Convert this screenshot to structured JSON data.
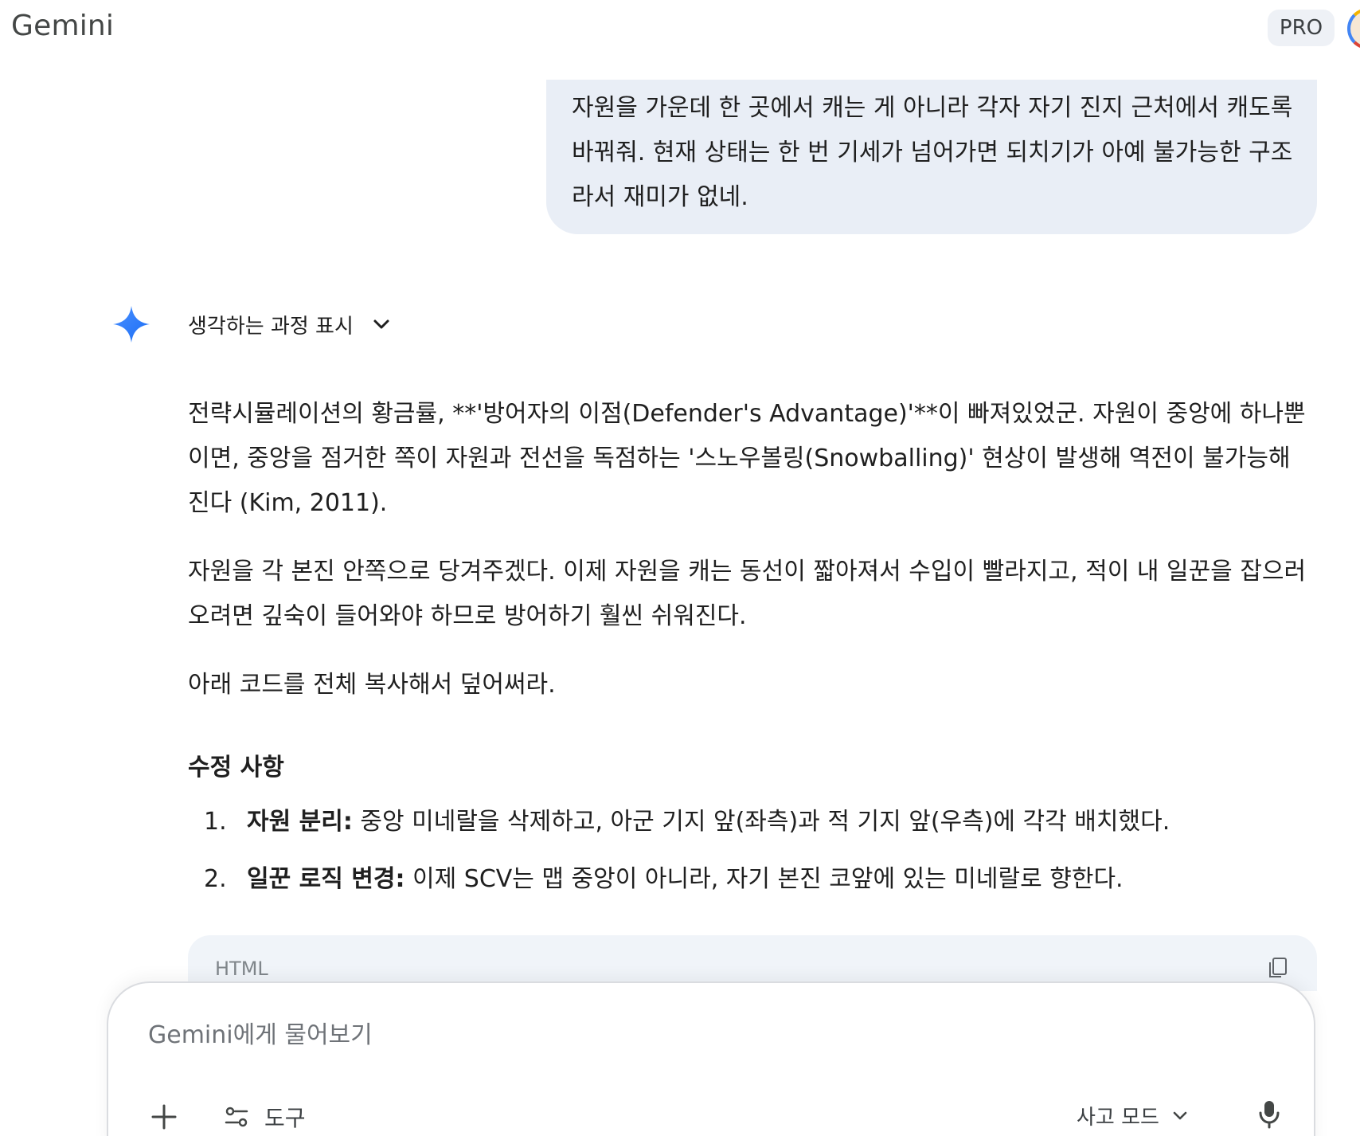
{
  "app": {
    "title": "Gemini",
    "pro_label": "PRO"
  },
  "user_message": {
    "lines": [
      "자원을 가운데 한 곳에서 캐는 게 아니라 각자 자기 진지 근처에서 캐도록",
      "바꿔줘. 현재 상태는 한 번 기세가 넘어가면 되치기가 아예 불가능한 구조",
      "라서 재미가 없네."
    ]
  },
  "response": {
    "thinking_toggle_label": "생각하는 과정 표시",
    "paragraphs": [
      "전략시뮬레이션의 황금률, **'방어자의 이점(Defender's Advantage)'**이 빠져있었군. 자원이 중앙에 하나뿐이면, 중앙을 점거한 쪽이 자원과 전선을 독점하는 '스노우볼링(Snowballing)' 현상이 발생해 역전이 불가능해진다 (Kim, 2011).",
      "자원을 각 본진 안쪽으로 당겨주겠다. 이제 자원을 캐는 동선이 짧아져서 수입이 빨라지고, 적이 내 일꾼을 잡으러 오려면 깊숙이 들어와야 하므로 방어하기 훨씬 쉬워진다.",
      "아래 코드를 전체 복사해서 덮어써라."
    ],
    "section_title": "수정 사항",
    "list": [
      {
        "num": "1.",
        "bold": "자원 분리:",
        "text": " 중앙 미네랄을 삭제하고, 아군 기지 앞(좌측)과 적 기지 앞(우측)에 각각 배치했다."
      },
      {
        "num": "2.",
        "bold": "일꾼 로직 변경:",
        "text": " 이제 SCV는 맵 중앙이 아니라, 자기 본진 코앞에 있는 미네랄로 향한다."
      }
    ],
    "code_language": "HTML"
  },
  "input": {
    "placeholder": "Gemini에게 물어보기",
    "tools_label": "도구",
    "mode_label": "사고 모드"
  },
  "icons": {
    "spark": "gemini-spark-icon",
    "chevron": "chevron-down-icon",
    "copy": "copy-icon",
    "plus": "plus-icon",
    "tools": "tools-icon",
    "mic": "mic-icon"
  },
  "colors": {
    "bubble_bg": "#e9eef6",
    "code_bg": "#f0f4f9",
    "spark_start": "#4b90ff",
    "spark_end": "#1a6df5"
  }
}
